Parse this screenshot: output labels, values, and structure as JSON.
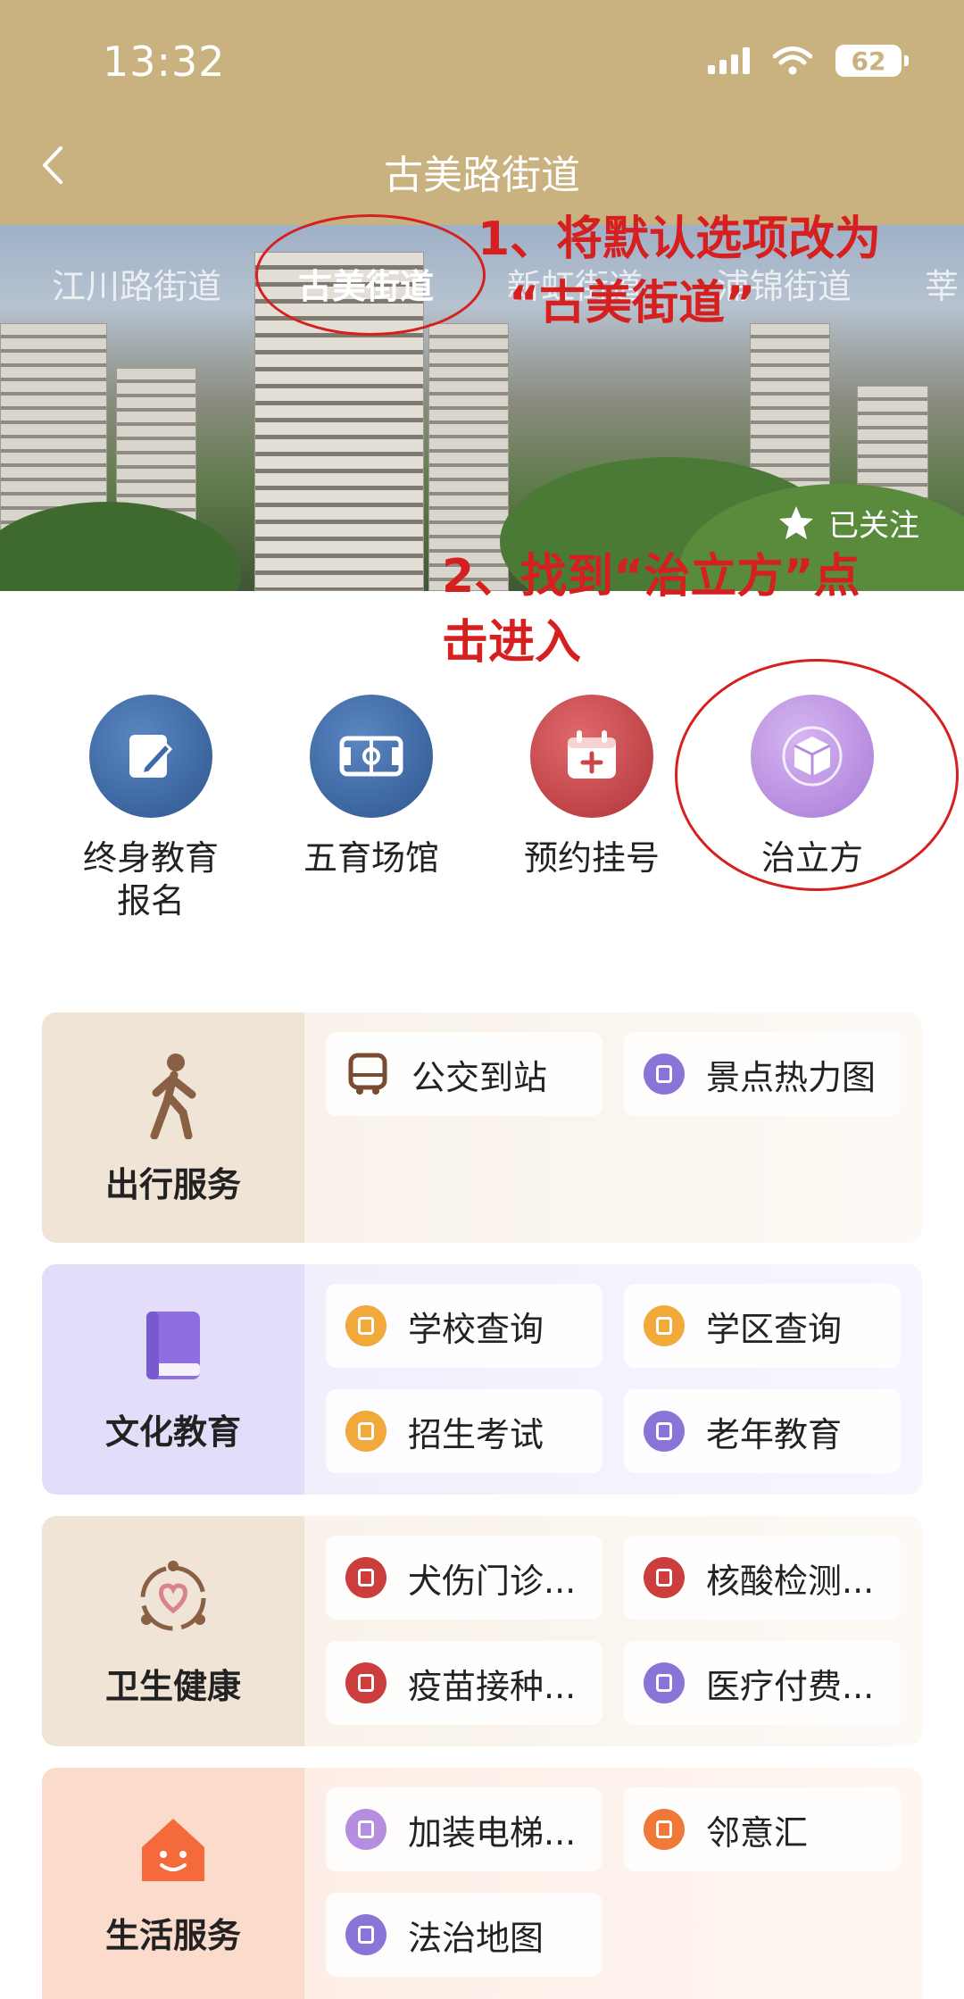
{
  "status_bar": {
    "time": "13:32",
    "battery": "62"
  },
  "header": {
    "title": "古美路街道"
  },
  "banner": {
    "tabs": [
      "江川路街道",
      "古美街道",
      "新虹街道",
      "浦锦街道",
      "莘"
    ],
    "active_tab": 1,
    "follow_label": "已关注"
  },
  "annotations": {
    "step1_line1": "1、将默认选项改为",
    "step1_line2": "“古美街道”",
    "step2_line1": "2、找到“治立方”点",
    "step2_line2": "击进入"
  },
  "quick_apps": [
    {
      "label": "终身教育\n报名",
      "icon": "edit-icon",
      "color": "#3f6aa6"
    },
    {
      "label": "五育场馆",
      "icon": "stadium-icon",
      "color": "#3f6aa6"
    },
    {
      "label": "预约挂号",
      "icon": "calendar-plus-icon",
      "color": "#c9474a"
    },
    {
      "label": "治立方",
      "icon": "cube-icon",
      "color": "#b68ee0"
    }
  ],
  "services": [
    {
      "title": "出行服务",
      "icon": "walk-icon",
      "items": [
        {
          "label": "公交到站",
          "icon": "bus-icon",
          "color": "#7a4a32"
        },
        {
          "label": "景点热力图",
          "icon": "app-icon",
          "color": "#8a74d8"
        }
      ]
    },
    {
      "title": "文化教育",
      "icon": "book-icon",
      "items": [
        {
          "label": "学校查询",
          "icon": "school-icon",
          "color": "#f0a93a"
        },
        {
          "label": "学区查询",
          "icon": "location-icon",
          "color": "#f0a93a"
        },
        {
          "label": "招生考试",
          "icon": "exam-icon",
          "color": "#f0a93a"
        },
        {
          "label": "老年教育",
          "icon": "app-icon",
          "color": "#8a74d8"
        }
      ]
    },
    {
      "title": "卫生健康",
      "icon": "health-icon",
      "items": [
        {
          "label": "犬伤门诊...",
          "icon": "dog-icon",
          "color": "#cc3d3d"
        },
        {
          "label": "核酸检测...",
          "icon": "test-tube-icon",
          "color": "#cc3d3d"
        },
        {
          "label": "疫苗接种...",
          "icon": "syringe-icon",
          "color": "#cc3d3d"
        },
        {
          "label": "医疗付费...",
          "icon": "app-icon",
          "color": "#8a74d8"
        }
      ]
    },
    {
      "title": "生活服务",
      "icon": "home-smile-icon",
      "items": [
        {
          "label": "加装电梯...",
          "icon": "elevator-icon",
          "color": "#b68ee0"
        },
        {
          "label": "邻意汇",
          "icon": "badge-icon",
          "color": "#f07838"
        },
        {
          "label": "法治地图",
          "icon": "app-icon",
          "color": "#8a74d8"
        }
      ]
    }
  ]
}
